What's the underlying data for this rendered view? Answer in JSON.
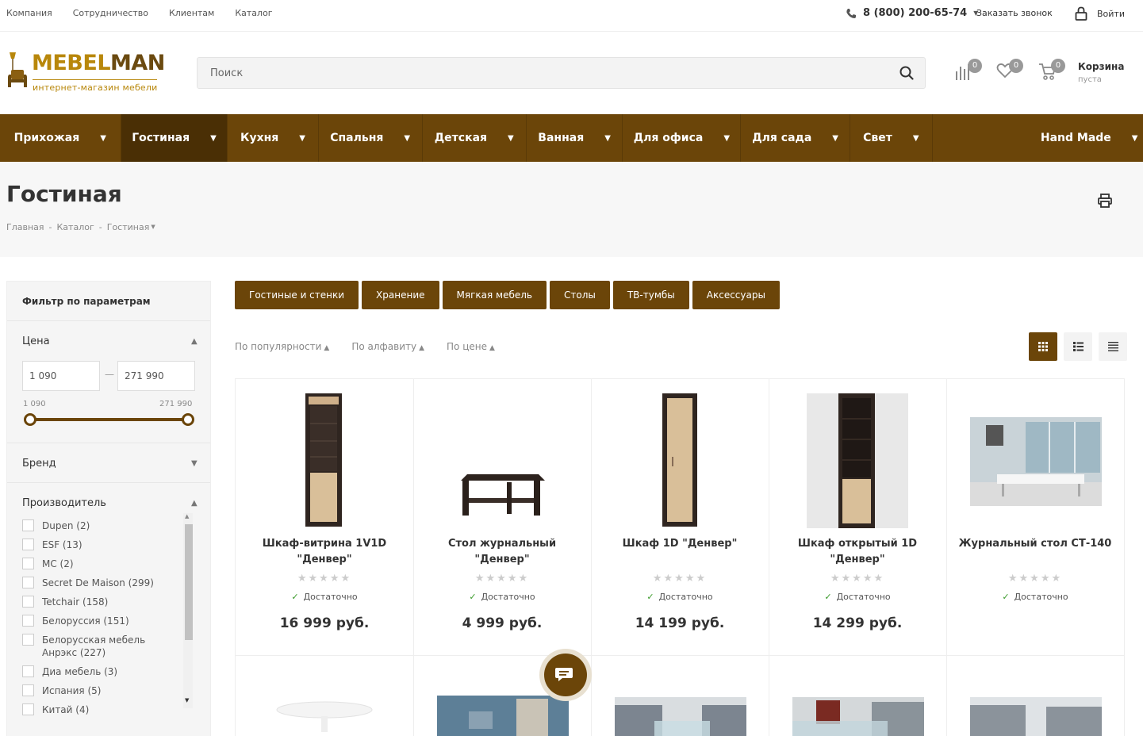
{
  "topbar": {
    "links": [
      "Компания",
      "Сотрудничество",
      "Клиентам",
      "Каталог"
    ],
    "phone": "8 (800) 200-65-74",
    "call_link": "Заказать звонок",
    "login": "Войти"
  },
  "logo": {
    "title_light": "MEBEL",
    "title_dark": "MAN",
    "subtitle": "интернет-магазин мебели"
  },
  "search": {
    "placeholder": "Поиск"
  },
  "header_counts": {
    "compare": "0",
    "favorites": "0",
    "cart": "0"
  },
  "cart": {
    "title": "Корзина",
    "status": "пуста"
  },
  "nav": {
    "items": [
      "Прихожая",
      "Гостиная",
      "Кухня",
      "Спальня",
      "Детская",
      "Ванная",
      "Для офиса",
      "Для сада",
      "Свет",
      "Hand Made"
    ],
    "active": "Гостиная"
  },
  "page": {
    "title": "Гостиная",
    "breadcrumbs": [
      "Главная",
      "-",
      "Каталог",
      "-",
      "Гостиная"
    ]
  },
  "filter": {
    "heading": "Фильтр по параметрам",
    "price_label": "Цена",
    "price_min": "1 090",
    "price_max": "271 990",
    "range_min_label": "1 090",
    "range_max_label": "271 990",
    "brand_label": "Бренд",
    "maker_label": "Производитель",
    "makers": [
      "Dupen (2)",
      "ESF (13)",
      "MC (2)",
      "Secret De Maison (299)",
      "Tetchair (158)",
      "Белоруссия (151)",
      "Белорусская мебель Анрэкс (227)",
      "Диа мебель (3)",
      "Испания (5)",
      "Китай (4)"
    ]
  },
  "tags": [
    "Гостиные и стенки",
    "Хранение",
    "Мягкая мебель",
    "Столы",
    "ТВ-тумбы",
    "Аксессуары"
  ],
  "sort": {
    "popularity": "По популярности",
    "alphabet": "По алфавиту",
    "price": "По цене"
  },
  "products": [
    {
      "name": "Шкаф-витрина 1V1D \"Денвер\"",
      "stock": "Достаточно",
      "price": "16 999 руб."
    },
    {
      "name": "Стол журнальный \"Денвер\"",
      "stock": "Достаточно",
      "price": "4 999 руб."
    },
    {
      "name": "Шкаф 1D \"Денвер\"",
      "stock": "Достаточно",
      "price": "14 199 руб."
    },
    {
      "name": "Шкаф открытый 1D \"Денвер\"",
      "stock": "Достаточно",
      "price": "14 299 руб."
    },
    {
      "name": "Журнальный стол СТ-140",
      "stock": "Достаточно",
      "price": ""
    }
  ],
  "stars": "★★★★★",
  "colors": {
    "brand": "#6b4509",
    "brand_dark": "#4a2f05",
    "logo_gold": "#b8870b",
    "in_stock": "#3a9a2a"
  }
}
